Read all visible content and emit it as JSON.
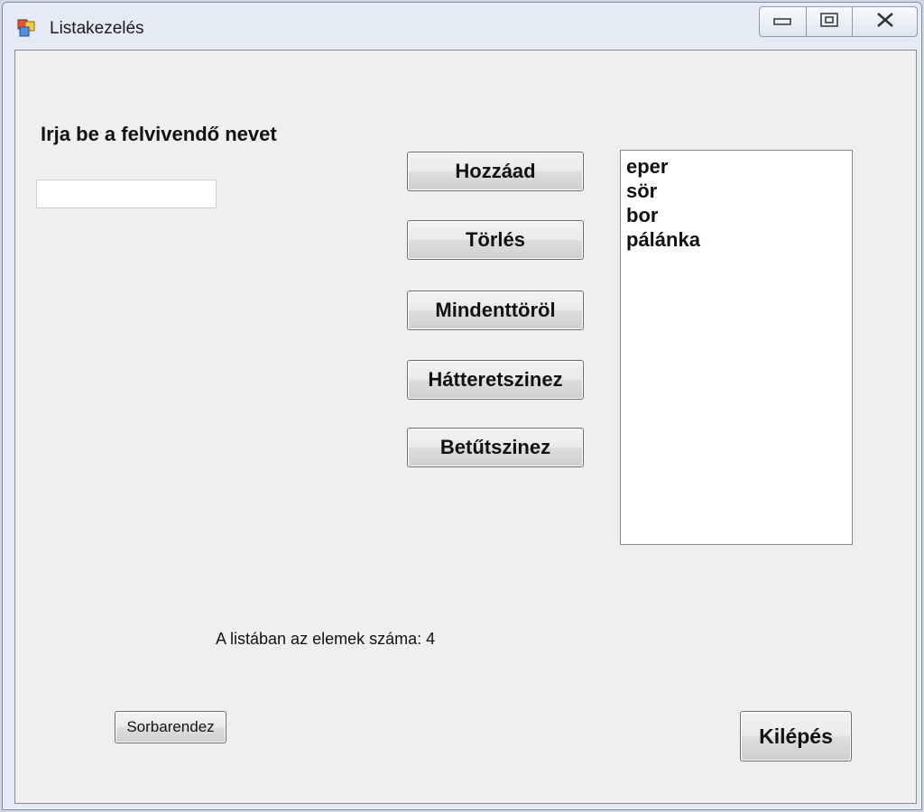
{
  "window": {
    "title": "Listakezelés"
  },
  "form": {
    "prompt_label": "Irja be a felvivendő nevet",
    "name_input_value": ""
  },
  "buttons": {
    "add": "Hozzáad",
    "delete": "Törlés",
    "delete_all": "Mindenttöröl",
    "background_color": "Hátteretszinez",
    "font_color": "Betűtszinez",
    "sort": "Sorbarendez",
    "exit": "Kilépés"
  },
  "list": {
    "items": [
      "eper",
      "sör",
      "bor",
      "pálánka"
    ]
  },
  "status": {
    "count_label": "A listában az elemek száma:",
    "count_value": "4"
  },
  "icons": {
    "app": "app-window-icon",
    "minimize": "minimize-icon",
    "maximize": "maximize-icon",
    "close": "close-icon"
  }
}
